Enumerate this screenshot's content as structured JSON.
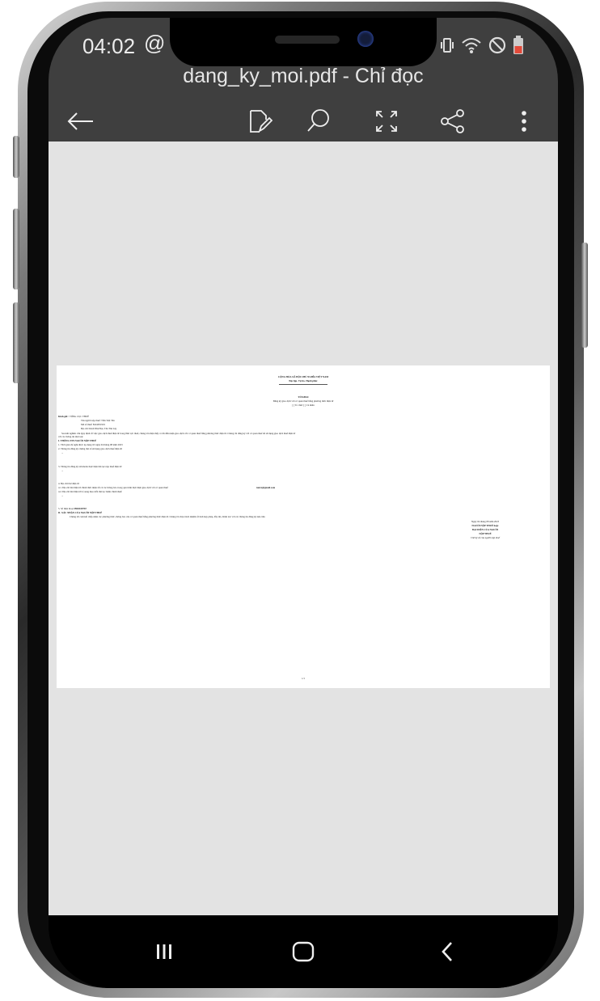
{
  "status_bar": {
    "time": "04:02",
    "at_icon": "@",
    "icons": [
      "vibrate-icon",
      "wifi-icon",
      "do-not-disturb-icon",
      "battery-icon"
    ]
  },
  "app_bar": {
    "title": "dang_ky_moi.pdf - Chỉ đọc",
    "actions": [
      "back-arrow-icon",
      "edit-icon",
      "search-icon",
      "fullscreen-icon",
      "share-icon",
      "more-vert-icon"
    ]
  },
  "document": {
    "header_line1": "CỘNG HÒA XÃ HỘI CHỦ NGHĨA VIỆT NAM",
    "header_line2": "Độc lập- Tự do- Hạnh phúc",
    "form_title": "TỜ KHAI",
    "form_subtitle": "Đăng ký giao dịch với cơ quan thuế bằng phương thức điện tử",
    "form_subtitle2": "[ ] Tổ chức [ ] Cá nhân",
    "to_label": "Kính gửi :",
    "to_value": "TỔNG CỤC THUẾ",
    "taxpayer_name": "Tên người nộp thuế:  Trần Việt Tân",
    "tax_code": "Mã số thuế:  8224051919",
    "address": "Địa chỉ:  Kinh Như Đạt, Tân Tân Lập",
    "intro_text": "Sau khi nghiên cứu Quy định về việc giao dịch thuế điện tử trong lĩnh vực thuế, chúng tôi nhận thấy có đủ điều kiện giao dịch với cơ quan thuế bằng phương thức điện tử. Chúng tôi đăng ký với cơ quan thuế để sử dụng giao dịch thuế điện tử",
    "intro_text2": "với các thông tin như sau:",
    "section1": "I. THÔNG TIN NGƯỜI NỘP THUẾ",
    "item1": "1. Thời gian để nghị được áp dụng từ:  ngày 04 tháng 08 năm 2023",
    "item2": "2. Thông tin đăng ký chứng thư số sử dụng giao dịch thuế điện tử:",
    "item2_dash": "...",
    "item3": "3. Thông tin đăng ký tài khoản thực hiện thủ tục nộp thuế điện tử:",
    "item3_dash": "...",
    "item4": "4. Địa chỉ thư điện tử:",
    "item4_1": "4.1. Địa chỉ thư điện tử chính thức nhận tất cả các thông báo trong quá trình thực hiện giao dịch với cơ quan thuế:",
    "item4_1_email": "tanxx@gmail.com",
    "item4_2": "4.2. Địa chỉ thư điện tử bổ sung theo mỗi thủ tục hành chính thuế:",
    "item4_2_dash": "...",
    "item5_label": "5. Số điện thoại:",
    "item5_value": "0902100767",
    "section2": "II. XÁC NHẬN CỦA NGƯỜI NỘP THUẾ",
    "confirm_text": "Chúng tôi cam kết chấp nhận các phương thức, thông báo của cơ quan thuế bằng phương thức điện tử. Chúng tôi chịu trách nhiệm về tính hợp pháp, đầy đủ, chính xác với các thông tin đăng ký nêu trên",
    "sig_date": "Ngày 04 tháng 08 năm 2023",
    "sig_title1": "NGƯỜI NỘP THUẾ hoặc",
    "sig_title2": "ĐẠI DIỆN CỦA NGƯỜI",
    "sig_title3": "NỘP THUẾ",
    "sig_note": "Chữ ký số của người nộp thuế",
    "page_number": "1/1"
  },
  "nav_bar": {
    "buttons": [
      "recents-icon",
      "home-icon",
      "back-icon"
    ]
  }
}
